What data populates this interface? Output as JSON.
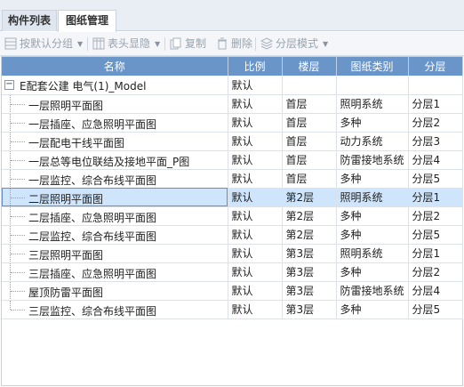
{
  "tabs": [
    {
      "label": "构件列表"
    },
    {
      "label": "图纸管理"
    }
  ],
  "toolbar": {
    "group_default": "按默认分组",
    "header_toggle": "表头显隐",
    "copy": "复制",
    "delete": "删除",
    "layer_mode": "分层模式"
  },
  "table": {
    "headers": [
      "名称",
      "比例",
      "楼层",
      "图纸类别",
      "分层"
    ],
    "root": {
      "name": "E配套公建 电气(1)_Model",
      "scale": "默认"
    },
    "rows": [
      {
        "name": "一层照明平面图",
        "scale": "默认",
        "floor": "首层",
        "category": "照明系统",
        "layer": "分层1"
      },
      {
        "name": "一层插座、应急照明平面图",
        "scale": "默认",
        "floor": "首层",
        "category": "多种",
        "layer": "分层2"
      },
      {
        "name": "一层配电干线平面图",
        "scale": "默认",
        "floor": "首层",
        "category": "动力系统",
        "layer": "分层3"
      },
      {
        "name": "一层总等电位联结及接地平面_P图",
        "scale": "默认",
        "floor": "首层",
        "category": "防雷接地系统",
        "layer": "分层4"
      },
      {
        "name": "一层监控、综合布线平面图",
        "scale": "默认",
        "floor": "首层",
        "category": "多种",
        "layer": "分层5"
      },
      {
        "name": "二层照明平面图",
        "scale": "默认",
        "floor": "第2层",
        "category": "照明系统",
        "layer": "分层1"
      },
      {
        "name": "二层插座、应急照明平面图",
        "scale": "默认",
        "floor": "第2层",
        "category": "多种",
        "layer": "分层2"
      },
      {
        "name": "二层监控、综合布线平面图",
        "scale": "默认",
        "floor": "第2层",
        "category": "多种",
        "layer": "分层5"
      },
      {
        "name": "三层照明平面图",
        "scale": "默认",
        "floor": "第3层",
        "category": "照明系统",
        "layer": "分层1"
      },
      {
        "name": "三层插座、应急照明平面图",
        "scale": "默认",
        "floor": "第3层",
        "category": "多种",
        "layer": "分层2"
      },
      {
        "name": "屋顶防雷平面图",
        "scale": "默认",
        "floor": "第3层",
        "category": "防雷接地系统",
        "layer": "分层4"
      },
      {
        "name": "三层监控、综合布线平面图",
        "scale": "默认",
        "floor": "第3层",
        "category": "多种",
        "layer": "分层5"
      }
    ]
  }
}
